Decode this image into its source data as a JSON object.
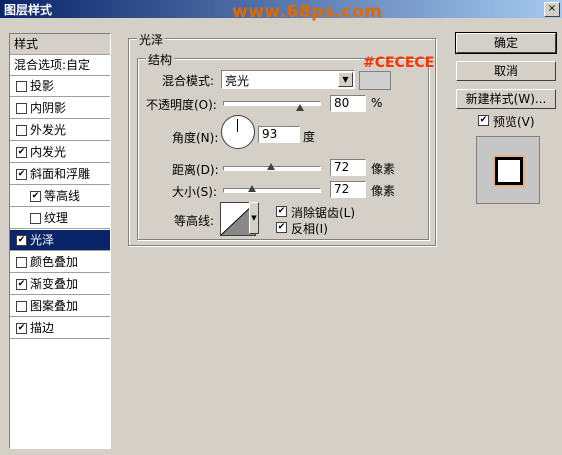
{
  "window": {
    "title": "图层样式",
    "watermark": "www.68ps.com",
    "close_glyph": "×"
  },
  "left_panel": {
    "header": "样式",
    "blend_options": "混合选项:自定",
    "items": [
      {
        "label": "投影",
        "checked": false,
        "indent": false,
        "selected": false
      },
      {
        "label": "内阴影",
        "checked": false,
        "indent": false,
        "selected": false
      },
      {
        "label": "外发光",
        "checked": false,
        "indent": false,
        "selected": false
      },
      {
        "label": "内发光",
        "checked": true,
        "indent": false,
        "selected": false
      },
      {
        "label": "斜面和浮雕",
        "checked": true,
        "indent": false,
        "selected": false
      },
      {
        "label": "等高线",
        "checked": true,
        "indent": true,
        "selected": false
      },
      {
        "label": "纹理",
        "checked": false,
        "indent": true,
        "selected": false
      },
      {
        "label": "光泽",
        "checked": true,
        "indent": false,
        "selected": true
      },
      {
        "label": "颜色叠加",
        "checked": false,
        "indent": false,
        "selected": false
      },
      {
        "label": "渐变叠加",
        "checked": true,
        "indent": false,
        "selected": false
      },
      {
        "label": "图案叠加",
        "checked": false,
        "indent": false,
        "selected": false
      },
      {
        "label": "描边",
        "checked": true,
        "indent": false,
        "selected": false
      }
    ]
  },
  "satin": {
    "group_title": "光泽",
    "structure_title": "结构",
    "blend_mode_label": "混合模式:",
    "blend_mode_value": "亮光",
    "color_hex": "#CECECE",
    "opacity_label": "不透明度(O):",
    "opacity_value": "80",
    "opacity_unit": "%",
    "opacity_fraction": 0.8,
    "angle_label": "角度(N):",
    "angle_value": "93",
    "angle_unit": "度",
    "distance_label": "距离(D):",
    "distance_value": "72",
    "distance_unit": "像素",
    "distance_fraction": 0.5,
    "size_label": "大小(S):",
    "size_value": "72",
    "size_unit": "像素",
    "size_fraction": 0.3,
    "contour_label": "等高线:",
    "antialias_label": "消除锯齿(L)",
    "antialias_checked": true,
    "invert_label": "反相(I)",
    "invert_checked": true
  },
  "buttons": {
    "ok": "确定",
    "cancel": "取消",
    "new_style": "新建样式(W)...",
    "preview_label": "预览(V)",
    "preview_checked": true
  }
}
